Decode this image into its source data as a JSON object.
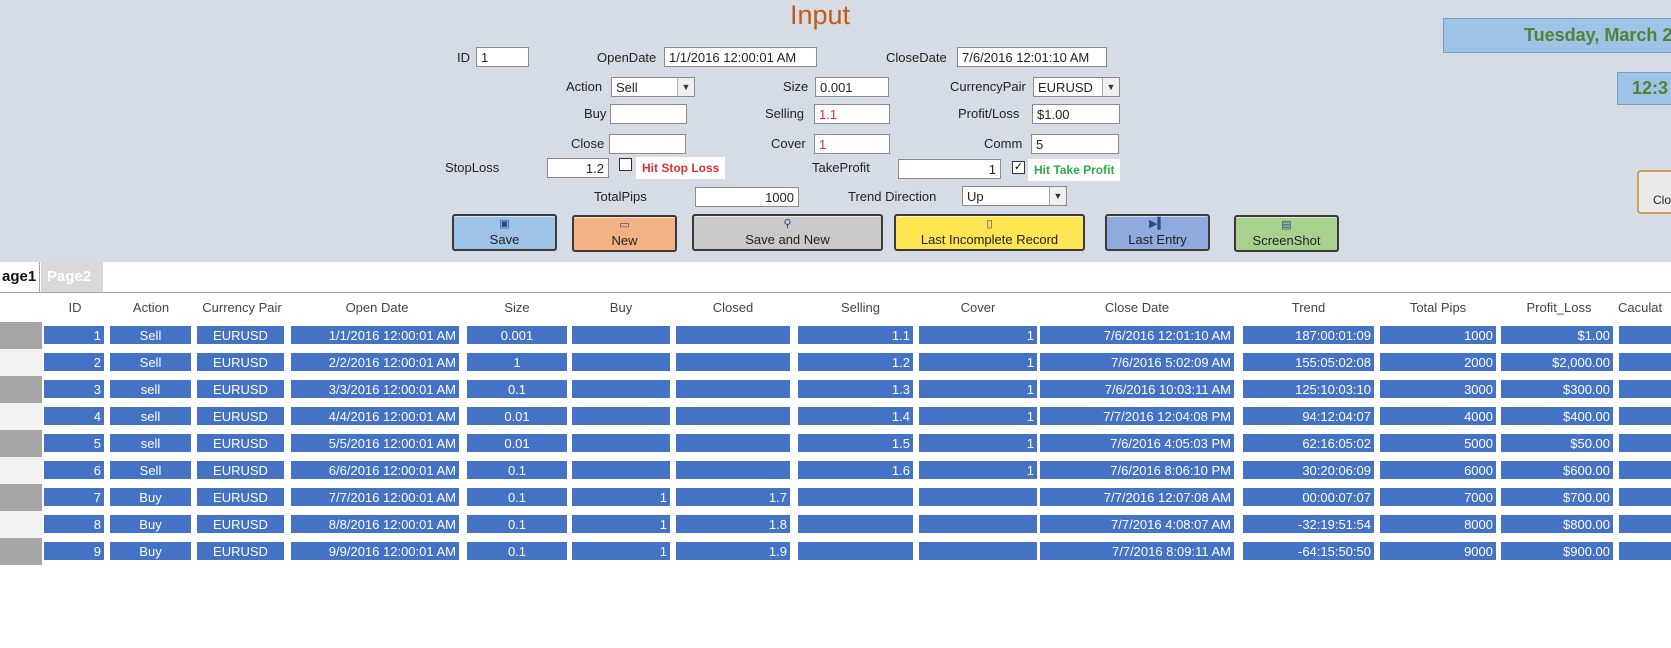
{
  "form": {
    "title": "Input",
    "labels": {
      "id": "ID",
      "open_date": "OpenDate",
      "close_date": "CloseDate",
      "action": "Action",
      "size": "Size",
      "currency_pair": "CurrencyPair",
      "buy": "Buy",
      "selling": "Selling",
      "profit_loss": "Profit/Loss",
      "close": "Close",
      "cover": "Cover",
      "comm": "Comm",
      "stop_loss": "StopLoss",
      "take_profit": "TakeProfit",
      "total_pips": "TotalPips",
      "trend_direction": "Trend Direction"
    },
    "values": {
      "id": "1",
      "open_date": "1/1/2016 12:00:01 AM",
      "close_date": "7/6/2016 12:01:10 AM",
      "action": "Sell",
      "size": "0.001",
      "currency_pair": "EURUSD",
      "buy": "",
      "selling": "1.1",
      "profit_loss": "$1.00",
      "close": "",
      "cover": "1",
      "comm": "5",
      "stop_loss": "1.2",
      "take_profit": "1",
      "total_pips": "1000",
      "trend_direction": "Up"
    },
    "hit_stop_loss": {
      "label": "Hit Stop Loss",
      "checked": false,
      "color": "#e03030"
    },
    "hit_take_profit": {
      "label": "Hit Take Profit",
      "checked": true,
      "color": "#2eaa4a"
    }
  },
  "buttons": {
    "save": "Save",
    "new": "New",
    "save_and_new": "Save and New",
    "last_incomplete": "Last Incomplete Record",
    "last_entry": "Last Entry",
    "screenshot": "ScreenShot",
    "close_partial": "Clo"
  },
  "header_right": {
    "date": "Tuesday, March 2",
    "time": "12:3"
  },
  "tabs": [
    "age1",
    "Page2"
  ],
  "table": {
    "columns": [
      "ID",
      "Action",
      "Currency Pair",
      "Open Date",
      "Size",
      "Buy",
      "Closed",
      "Selling",
      "Cover",
      "Close Date",
      "Trend",
      "Total Pips",
      "Profit_Loss",
      "Caculat"
    ],
    "rows": [
      [
        "1",
        "Sell",
        "EURUSD",
        "1/1/2016 12:00:01 AM",
        "0.001",
        "",
        "",
        "1.1",
        "1",
        "7/6/2016 12:01:10 AM",
        "187:00:01:09",
        "1000",
        "$1.00"
      ],
      [
        "2",
        "Sell",
        "EURUSD",
        "2/2/2016 12:00:01 AM",
        "1",
        "",
        "",
        "1.2",
        "1",
        "7/6/2016 5:02:09 AM",
        "155:05:02:08",
        "2000",
        "$2,000.00"
      ],
      [
        "3",
        "sell",
        "EURUSD",
        "3/3/2016 12:00:01 AM",
        "0.1",
        "",
        "",
        "1.3",
        "1",
        "7/6/2016 10:03:11 AM",
        "125:10:03:10",
        "3000",
        "$300.00"
      ],
      [
        "4",
        "sell",
        "EURUSD",
        "4/4/2016 12:00:01 AM",
        "0.01",
        "",
        "",
        "1.4",
        "1",
        "7/7/2016 12:04:08 PM",
        "94:12:04:07",
        "4000",
        "$400.00"
      ],
      [
        "5",
        "sell",
        "EURUSD",
        "5/5/2016 12:00:01 AM",
        "0.01",
        "",
        "",
        "1.5",
        "1",
        "7/6/2016 4:05:03 PM",
        "62:16:05:02",
        "5000",
        "$50.00"
      ],
      [
        "6",
        "Sell",
        "EURUSD",
        "6/6/2016 12:00:01 AM",
        "0.1",
        "",
        "",
        "1.6",
        "1",
        "7/6/2016 8:06:10 PM",
        "30:20:06:09",
        "6000",
        "$600.00"
      ],
      [
        "7",
        "Buy",
        "EURUSD",
        "7/7/2016 12:00:01 AM",
        "0.1",
        "1",
        "1.7",
        "",
        "",
        "7/7/2016 12:07:08 AM",
        "00:00:07:07",
        "7000",
        "$700.00"
      ],
      [
        "8",
        "Buy",
        "EURUSD",
        "8/8/2016 12:00:01 AM",
        "0.1",
        "1",
        "1.8",
        "",
        "",
        "7/7/2016 4:08:07 AM",
        "-32:19:51:54",
        "8000",
        "$800.00"
      ],
      [
        "9",
        "Buy",
        "EURUSD",
        "9/9/2016 12:00:01 AM",
        "0.1",
        "1",
        "1.9",
        "",
        "",
        "7/7/2016 8:09:11 AM",
        "-64:15:50:50",
        "9000",
        "$900.00"
      ]
    ]
  },
  "colors": {
    "form_bg": "#d6dce5",
    "cell_bg": "#4472c4",
    "title": "#c55a11",
    "date_text": "#548235"
  }
}
